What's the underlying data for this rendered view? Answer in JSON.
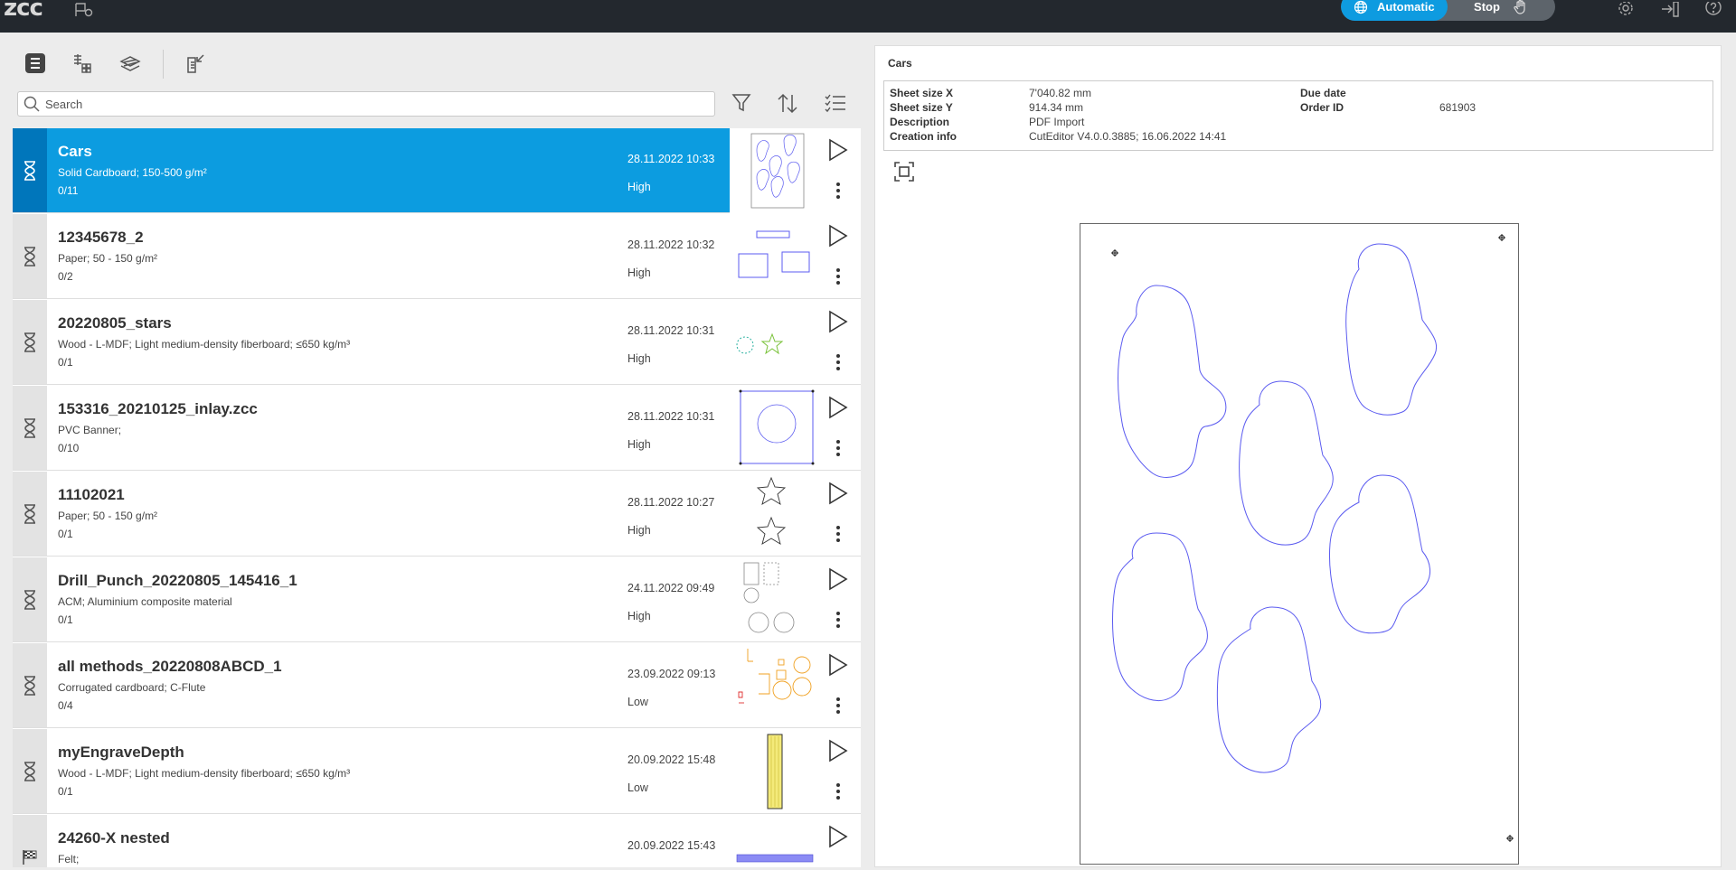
{
  "app": {
    "logo": "zcc"
  },
  "topbar": {
    "mode_auto_label": "Automatic",
    "mode_stop_label": "Stop"
  },
  "search": {
    "placeholder": "Search"
  },
  "jobs": [
    {
      "name": "Cars",
      "material": "Solid Cardboard; 150-500 g/m²",
      "count": "0/11",
      "date": "28.11.2022 10:33",
      "priority": "High",
      "status": "waiting",
      "selected": true
    },
    {
      "name": "12345678_2",
      "material": "Paper; 50 - 150 g/m²",
      "count": "0/2",
      "date": "28.11.2022 10:32",
      "priority": "High",
      "status": "waiting"
    },
    {
      "name": "20220805_stars",
      "material": "Wood - L-MDF; Light medium-density fiberboard; ≤650 kg/m³",
      "count": "0/1",
      "date": "28.11.2022 10:31",
      "priority": "High",
      "status": "waiting"
    },
    {
      "name": "153316_20210125_inlay.zcc",
      "material": "PVC Banner;",
      "count": "0/10",
      "date": "28.11.2022 10:31",
      "priority": "High",
      "status": "waiting"
    },
    {
      "name": "11102021",
      "material": "Paper; 50 - 150 g/m²",
      "count": "0/1",
      "date": "28.11.2022 10:27",
      "priority": "High",
      "status": "waiting"
    },
    {
      "name": "Drill_Punch_20220805_145416_1",
      "material": "ACM; Aluminium composite material",
      "count": "0/1",
      "date": "24.11.2022 09:49",
      "priority": "High",
      "status": "waiting"
    },
    {
      "name": "all methods_20220808ABCD_1",
      "material": "Corrugated cardboard; C-Flute",
      "count": "0/4",
      "date": "23.09.2022 09:13",
      "priority": "Low",
      "status": "waiting"
    },
    {
      "name": "myEngraveDepth",
      "material": "Wood - L-MDF; Light medium-density fiberboard; ≤650 kg/m³",
      "count": "0/1",
      "date": "20.09.2022 15:48",
      "priority": "Low",
      "status": "waiting"
    },
    {
      "name": "24260-X nested",
      "material": "Felt;",
      "count": "",
      "date": "20.09.2022 15:43",
      "priority": "",
      "status": "finished"
    }
  ],
  "detail": {
    "title": "Cars",
    "fields": {
      "sheet_size_x_label": "Sheet size X",
      "sheet_size_x": "7'040.82 mm",
      "sheet_size_y_label": "Sheet size Y",
      "sheet_size_y": "914.34 mm",
      "description_label": "Description",
      "description": "PDF Import",
      "creation_info_label": "Creation info",
      "creation_info": "CutEditor V4.0.0.3885; 16.06.2022 14:41",
      "due_date_label": "Due date",
      "due_date": "",
      "order_id_label": "Order ID",
      "order_id": "681903"
    }
  },
  "colors": {
    "accent": "#0c9ce0",
    "accent_dark": "#0076bb",
    "topbar": "#23282e",
    "cut_line": "#5b5bf0"
  }
}
